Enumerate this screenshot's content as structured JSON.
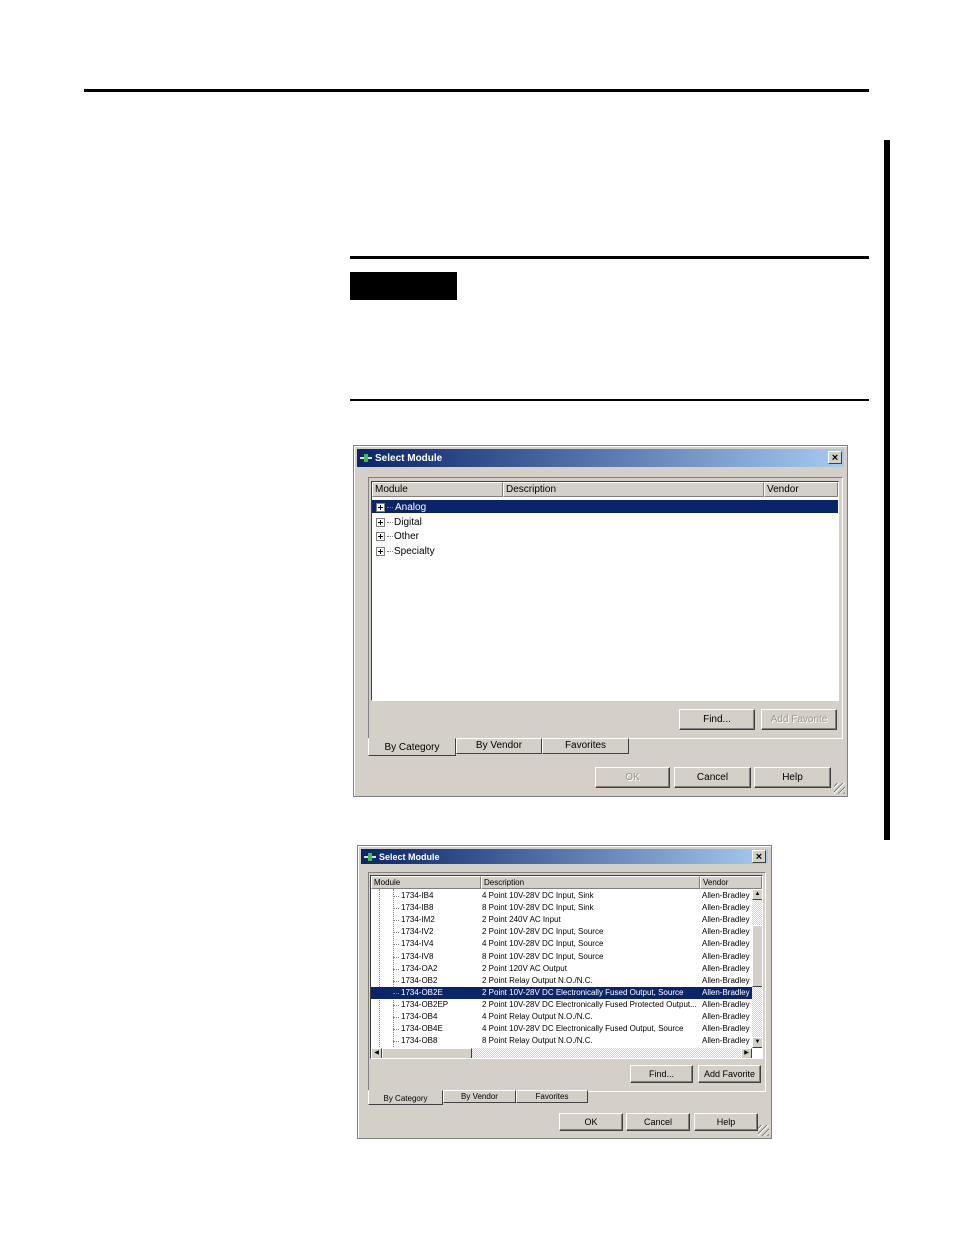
{
  "dialog1": {
    "title": "Select Module",
    "close_glyph": "×",
    "columns": [
      "Module",
      "Description",
      "Vendor"
    ],
    "tree": [
      {
        "label": "Analog",
        "selected": true
      },
      {
        "label": "Digital",
        "selected": false
      },
      {
        "label": "Other",
        "selected": false
      },
      {
        "label": "Specialty",
        "selected": false
      }
    ],
    "find_label": "Find...",
    "add_favorite_label": "Add Favorite",
    "tabs": [
      "By Category",
      "By Vendor",
      "Favorites"
    ],
    "ok_label": "OK",
    "cancel_label": "Cancel",
    "help_label": "Help"
  },
  "dialog2": {
    "title": "Select Module",
    "close_glyph": "×",
    "columns": [
      "Module",
      "Description",
      "Vendor"
    ],
    "rows": [
      {
        "module": "1734-IB4",
        "description": "4 Point 10V-28V DC Input, Sink",
        "vendor": "Allen-Bradley"
      },
      {
        "module": "1734-IB8",
        "description": "8 Point 10V-28V DC Input, Sink",
        "vendor": "Allen-Bradley"
      },
      {
        "module": "1734-IM2",
        "description": "2 Point 240V AC Input",
        "vendor": "Allen-Bradley"
      },
      {
        "module": "1734-IV2",
        "description": "2 Point 10V-28V DC Input, Source",
        "vendor": "Allen-Bradley"
      },
      {
        "module": "1734-IV4",
        "description": "4 Point 10V-28V DC Input, Source",
        "vendor": "Allen-Bradley"
      },
      {
        "module": "1734-IV8",
        "description": "8 Point 10V-28V DC Input, Source",
        "vendor": "Allen-Bradley"
      },
      {
        "module": "1734-OA2",
        "description": "2 Point 120V AC Output",
        "vendor": "Allen-Bradley"
      },
      {
        "module": "1734-OB2",
        "description": "2 Point Relay Output N.O./N.C.",
        "vendor": "Allen-Bradley"
      },
      {
        "module": "1734-OB2E",
        "description": "2 Point 10V-28V DC Electronically Fused Output, Source",
        "vendor": "Allen-Bradley"
      },
      {
        "module": "1734-OB2EP",
        "description": "2 Point 10V-28V DC Electronically Fused Protected Output...",
        "vendor": "Allen-Bradley"
      },
      {
        "module": "1734-OB4",
        "description": "4 Point Relay Output N.O./N.C.",
        "vendor": "Allen-Bradley"
      },
      {
        "module": "1734-OB4E",
        "description": "4 Point 10V-28V DC Electronically Fused Output, Source",
        "vendor": "Allen-Bradley"
      },
      {
        "module": "1734-OB8",
        "description": "8 Point Relay Output N.O./N.C.",
        "vendor": "Allen-Bradley"
      }
    ],
    "selected_row": 8,
    "find_label": "Find...",
    "add_favorite_label": "Add Favorite",
    "tabs": [
      "By Category",
      "By Vendor",
      "Favorites"
    ],
    "ok_label": "OK",
    "cancel_label": "Cancel",
    "help_label": "Help"
  }
}
